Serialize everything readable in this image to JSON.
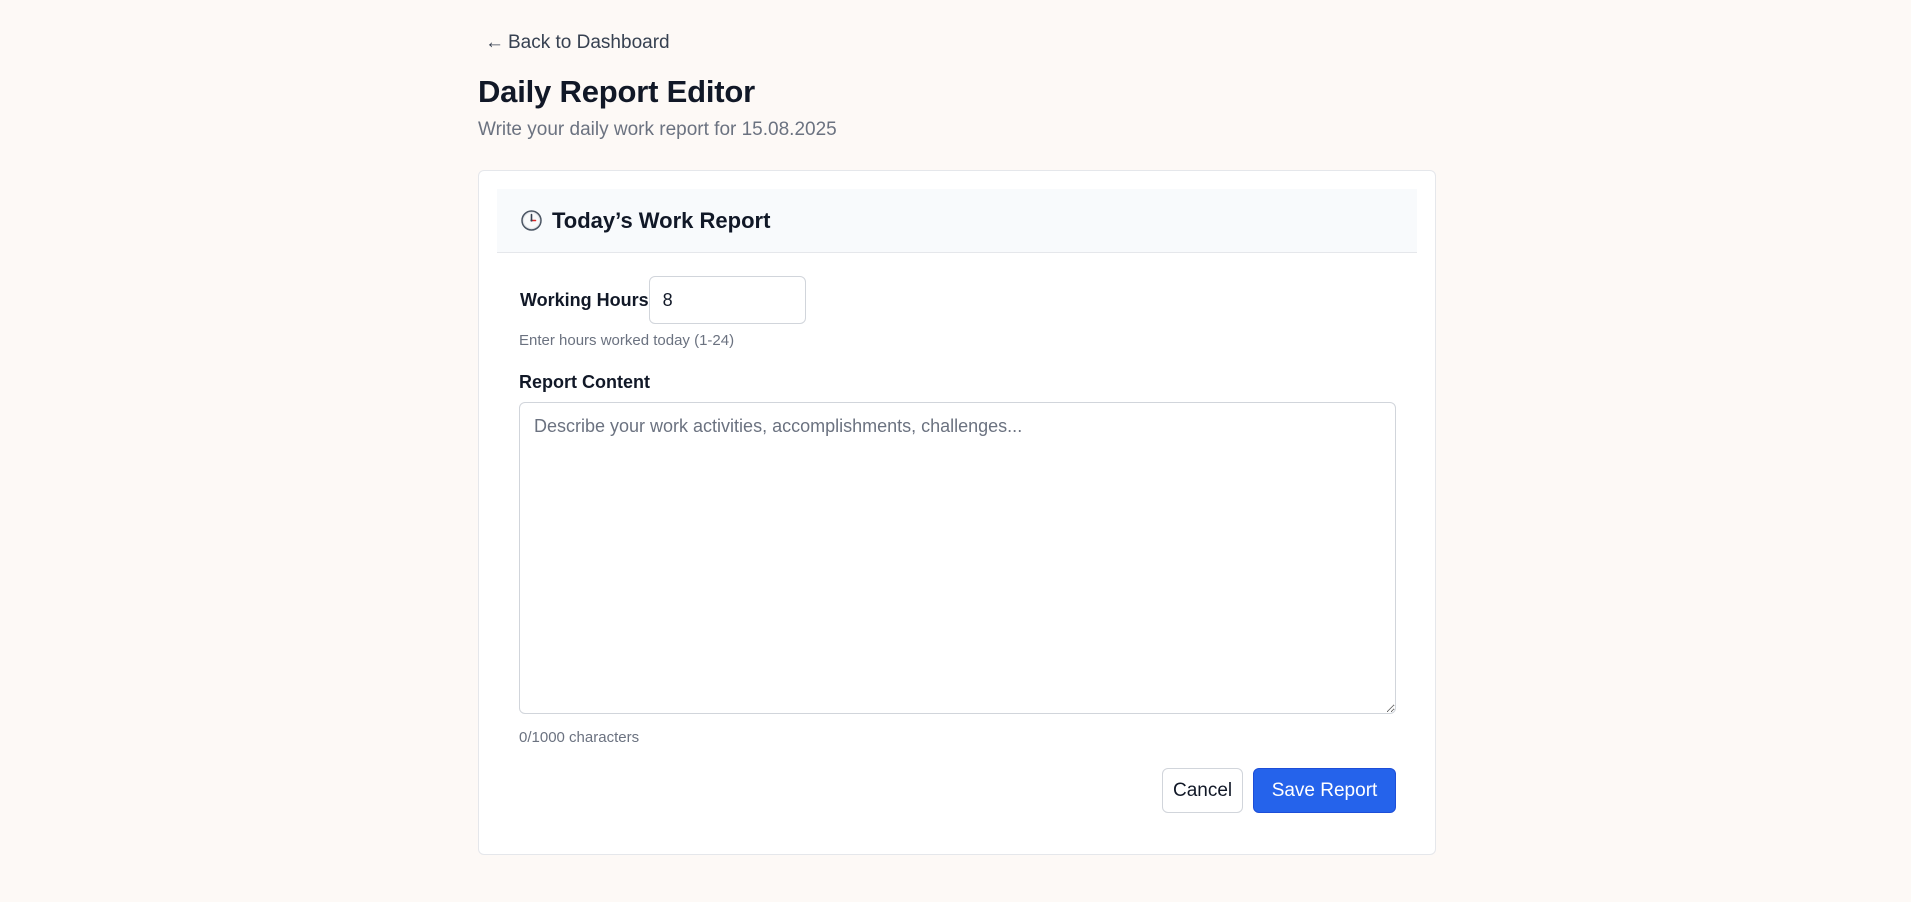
{
  "nav": {
    "back_arrow": "←",
    "back_label": "Back to Dashboard"
  },
  "page": {
    "title": "Daily Report Editor",
    "subtitle": "Write your daily work report for 15.08.2025"
  },
  "card": {
    "title": "Today’s Work Report",
    "icon": "clock-icon"
  },
  "hours": {
    "label": "Working Hours",
    "value": "8",
    "hint": "Enter hours worked today (1-24)"
  },
  "content": {
    "label": "Report Content",
    "placeholder": "Describe your work activities, accomplishments, challenges...",
    "value": "",
    "char_count": "0/1000 characters"
  },
  "actions": {
    "cancel_label": "Cancel",
    "save_label": "Save Report"
  },
  "colors": {
    "page_background": "#fdf9f6",
    "primary": "#2563eb",
    "header_background": "#f8fafc"
  }
}
